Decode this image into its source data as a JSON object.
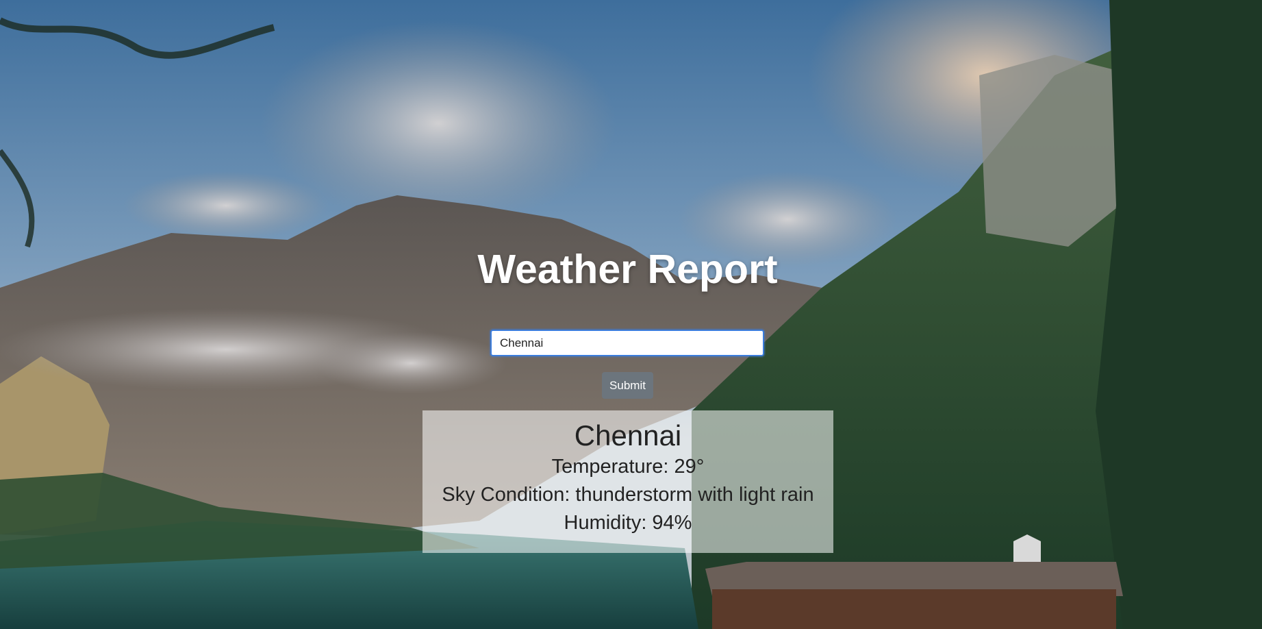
{
  "page": {
    "title": "Weather Report"
  },
  "search": {
    "value": "Chennai",
    "submit_label": "Submit"
  },
  "result": {
    "city": "Chennai",
    "temperature": "Temperature: 29°",
    "sky": "Sky Condition: thunderstorm with light rain",
    "humidity": "Humidity: 94%"
  },
  "colors": {
    "title_text": "#ffffff",
    "input_border": "#3b7ddd",
    "button_bg": "#6c757d",
    "card_bg": "rgba(255,255,255,0.55)"
  },
  "background": {
    "scene": "mountain-lake-landscape-image"
  }
}
